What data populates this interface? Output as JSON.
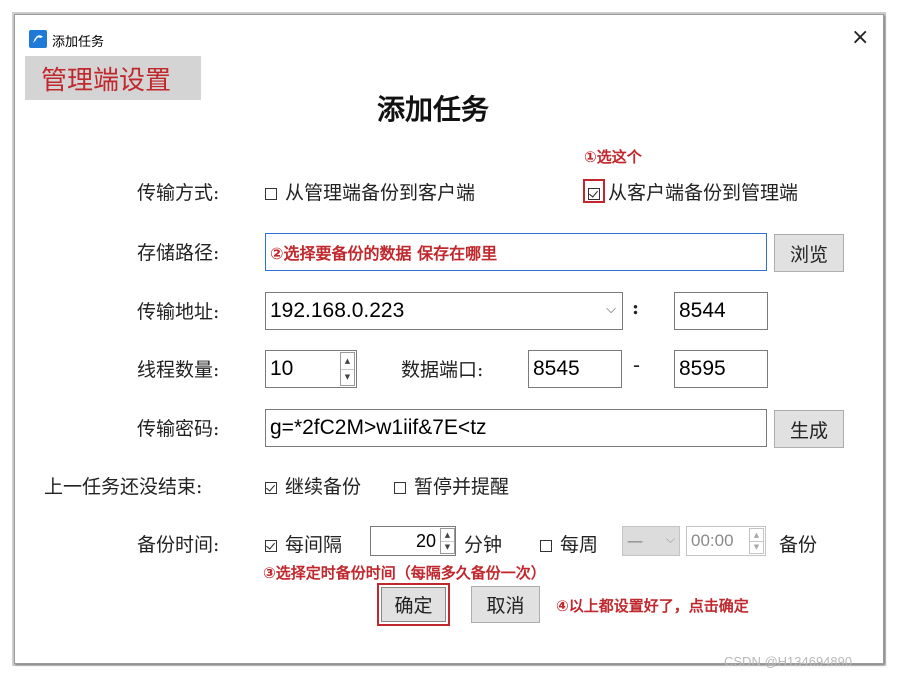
{
  "window": {
    "title": "添加任务",
    "close": "×"
  },
  "section_tab": "管理端设置",
  "heading": "添加任务",
  "transfer_mode": {
    "label": "传输方式:",
    "option_a": "从管理端备份到客户端",
    "option_b": "从客户端备份到管理端",
    "annotation": "①选这个"
  },
  "storage_path": {
    "label": "存储路径:",
    "value": "②选择要备份的数据 保存在哪里",
    "browse": "浏览"
  },
  "transfer_address": {
    "label": "传输地址:",
    "ip": "192.168.0.223",
    "colon": ":",
    "port": "8544"
  },
  "threads": {
    "label": "线程数量:",
    "value": "10",
    "port_label": "数据端口:",
    "port_from": "8545",
    "dash": "-",
    "port_to": "8595"
  },
  "password": {
    "label": "传输密码:",
    "value": "g=*2fC2M>w1iif&7E<tz",
    "generate": "生成"
  },
  "unfinished": {
    "label": "上一任务还没结束:",
    "continue": "继续备份",
    "pause": "暂停并提醒"
  },
  "backup_time": {
    "label": "备份时间:",
    "interval_label": "每间隔",
    "interval_value": "20",
    "minutes": "分钟",
    "weekly": "每周",
    "day_value": "一",
    "time_value": "00:00",
    "backup": "备份",
    "annotation": "③选择定时备份时间（每隔多久备份一次）"
  },
  "actions": {
    "ok": "确定",
    "cancel": "取消",
    "annotation": "④以上都设置好了，点击确定"
  },
  "watermark": "CSDN @H134694890"
}
